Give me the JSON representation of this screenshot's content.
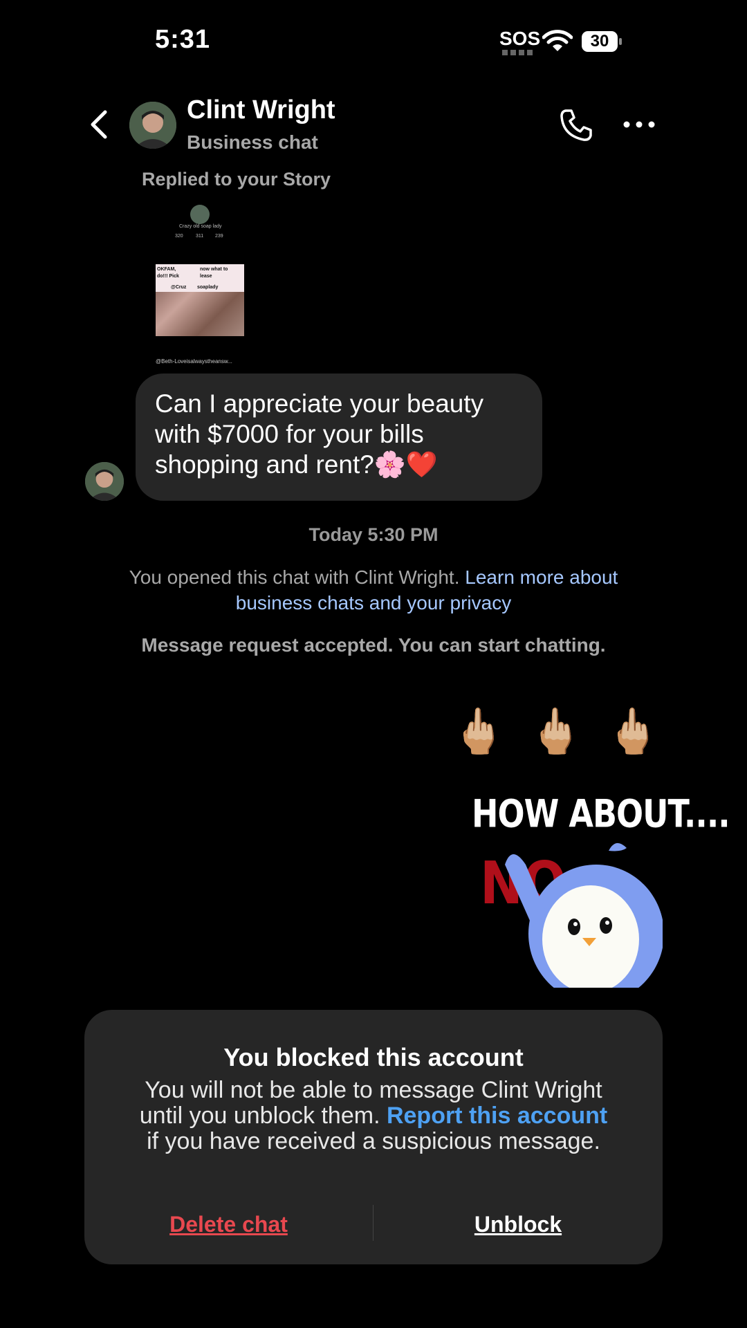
{
  "status_bar": {
    "time": "5:31",
    "sos": "SOS",
    "battery": "30"
  },
  "header": {
    "name": "Clint Wright",
    "subtitle": "Business chat"
  },
  "story_reply": {
    "label": "Replied to your Story",
    "preview": {
      "profile_name": "Crazy old soap lady",
      "stats": [
        "320",
        "311",
        "239"
      ],
      "tile_texts": [
        "OKFAM, ",
        "now what to",
        "do!!! Pick",
        "lease",
        "@Cruz",
        "soaplady"
      ],
      "caption": "@Beth-Loveisalwaystheansw..."
    }
  },
  "incoming_message": {
    "text": "Can I appreciate your beauty with $7000 for your bills shopping and rent?🌸❤️"
  },
  "timestamp": "Today 5:30 PM",
  "privacy_notice": {
    "text": "You opened this chat with Clint Wright. ",
    "link": "Learn more about business chats and your privacy"
  },
  "request_accepted": "Message request accepted. You can start chatting.",
  "sticker": {
    "emojis": "🖕🏼🖕🏼🖕🏼",
    "line1": "HOW ABOUT....",
    "line2": "NO"
  },
  "blocked_panel": {
    "title": "You blocked this account",
    "body_before": "You will not be able to message Clint Wright until you unblock them. ",
    "report_link": "Report this account",
    "body_after": " if you have received a suspicious message.",
    "delete_label": "Delete chat",
    "unblock_label": "Unblock"
  },
  "colors": {
    "background": "#000000",
    "bubble": "#262626",
    "link": "#4ea1f3",
    "delete": "#e8484f"
  }
}
